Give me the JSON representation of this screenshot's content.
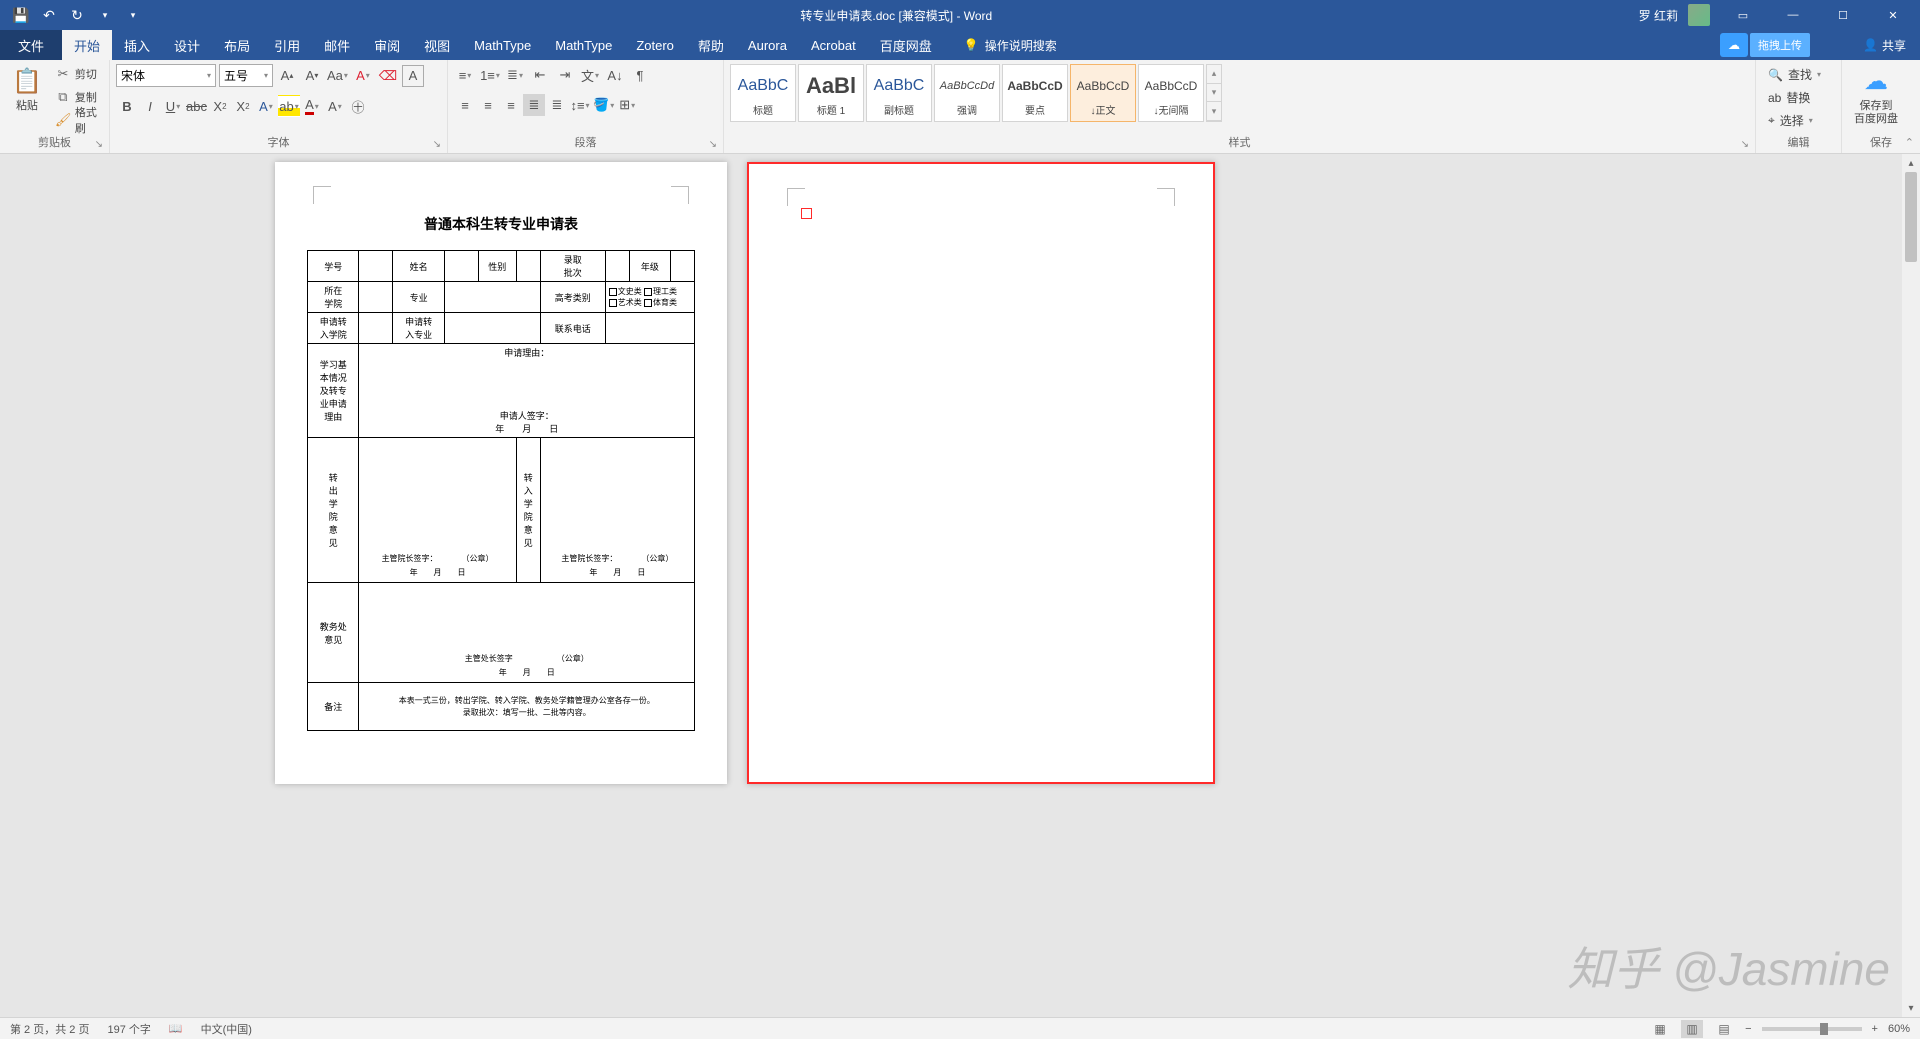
{
  "titlebar": {
    "doc_title": "转专业申请表.doc [兼容模式] - Word",
    "user": "罗 红莉"
  },
  "tabs": {
    "file": "文件",
    "items": [
      "开始",
      "插入",
      "设计",
      "布局",
      "引用",
      "邮件",
      "审阅",
      "视图",
      "MathType",
      "MathType",
      "Zotero",
      "帮助",
      "Aurora",
      "Acrobat",
      "百度网盘"
    ],
    "tell": "操作说明搜索",
    "share": "共享"
  },
  "cloud": {
    "label": "拖拽上传"
  },
  "ribbon": {
    "clipboard": {
      "label": "剪贴板",
      "paste": "粘贴",
      "cut": "剪切",
      "copy": "复制",
      "painter": "格式刷"
    },
    "font": {
      "label": "字体",
      "name": "宋体",
      "size": "五号"
    },
    "para": {
      "label": "段落"
    },
    "styles": {
      "label": "样式",
      "tiles": [
        {
          "prev": "AaBbC",
          "name": "标题",
          "cls": "bl"
        },
        {
          "prev": "AaBl",
          "name": "标题 1",
          "cls": "bo"
        },
        {
          "prev": "AaBbC",
          "name": "副标题",
          "cls": "bl"
        },
        {
          "prev": "AaBbCcDd",
          "name": "强调",
          "cls": "it"
        },
        {
          "prev": "AaBbCcD",
          "name": "要点",
          "cls": "bo"
        },
        {
          "prev": "AaBbCcD",
          "name": "↓正文",
          "cls": ""
        },
        {
          "prev": "AaBbCcD",
          "name": "↓无间隔",
          "cls": ""
        }
      ]
    },
    "edit": {
      "label": "编辑",
      "find": "查找",
      "replace": "替换",
      "select": "选择"
    },
    "save": {
      "label": "保存",
      "big": "保存到\n百度网盘"
    }
  },
  "doc": {
    "title": "普通本科生转专业申请表",
    "r1": [
      "学号",
      "",
      "姓名",
      "",
      "性别",
      "",
      "录取\n批次",
      "",
      "年级",
      ""
    ],
    "r2": [
      "所在\n学院",
      "",
      "专业",
      "",
      "",
      "高考类别"
    ],
    "r2opts": [
      "文史类",
      "理工类",
      "艺术类",
      "体育类"
    ],
    "r3": [
      "申请转\n入学院",
      "",
      "申请转\n入专业",
      "",
      "联系电话",
      ""
    ],
    "r4lab": "学习基\n本情况\n及转专\n业申请\n理由",
    "r4a": "申请理由：",
    "r4b": "申请人签字：",
    "r4c": "年　　月　　日",
    "r5a": "转\n出\n学\n院\n意\n见",
    "r5b": "转\n入\n学\n院\n意\n见",
    "r5sig": "主管院长签字：　　　　（公章）",
    "r5date": "年　　月　　日",
    "r6lab": "教务处\n意见",
    "r6sig": "主管处长签字　　　　　　（公章）",
    "r7lab": "备注",
    "r7txt": "本表一式三份，转出学院、转入学院、教务处学籍管理办公室各存一份。\n录取批次：填写一批、二批等内容。"
  },
  "status": {
    "page": "第 2 页，共 2 页",
    "words": "197 个字",
    "lang": "中文(中国)",
    "zoom": "60%"
  },
  "watermark": "知乎 @Jasmine"
}
